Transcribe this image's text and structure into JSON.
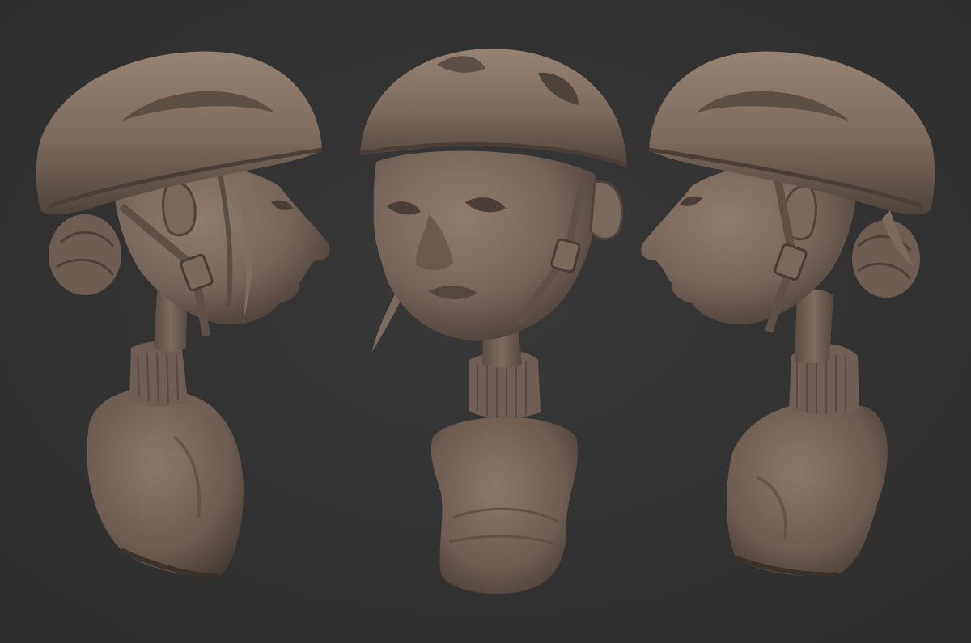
{
  "scene": {
    "colors": {
      "background": "#333333",
      "clay_light": "#8d7a6c",
      "clay_mid": "#6f5f54",
      "clay_dark": "#3f352f",
      "shadow": "#262220"
    },
    "views": [
      "left-profile",
      "front-three-quarter",
      "right-profile"
    ]
  }
}
